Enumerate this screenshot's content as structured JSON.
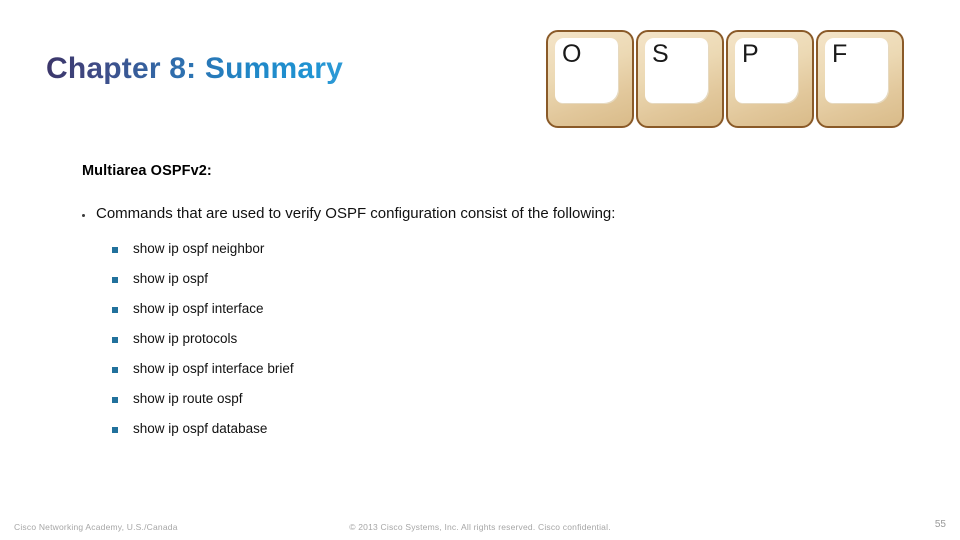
{
  "slide": {
    "title": "Chapter 8: Summary",
    "keys": [
      {
        "letter": "O"
      },
      {
        "letter": "S"
      },
      {
        "letter": "P"
      },
      {
        "letter": "F"
      }
    ],
    "sub_head": "Multiarea OSPFv2:",
    "lead_bullet": "Commands that are used to verify OSPF configuration consist of the following:",
    "commands": [
      "show ip ospf neighbor",
      "show ip ospf",
      "show ip ospf interface",
      "show ip protocols",
      "show ip ospf interface brief",
      "show ip route ospf",
      "show ip ospf database"
    ]
  },
  "footer": {
    "left": "Cisco Networking Academy, U.S./Canada",
    "center": "© 2013 Cisco Systems, Inc. All rights reserved. Cisco confidential.",
    "page_number": "55"
  },
  "colors": {
    "title_gradient_start": "#3b3568",
    "title_gradient_end": "#2f9ad6",
    "sub_bullet_square": "#21719c",
    "key_border": "#8a5a28",
    "key_body": "#e6cfa6",
    "footer_text": "#a6a6a6"
  }
}
